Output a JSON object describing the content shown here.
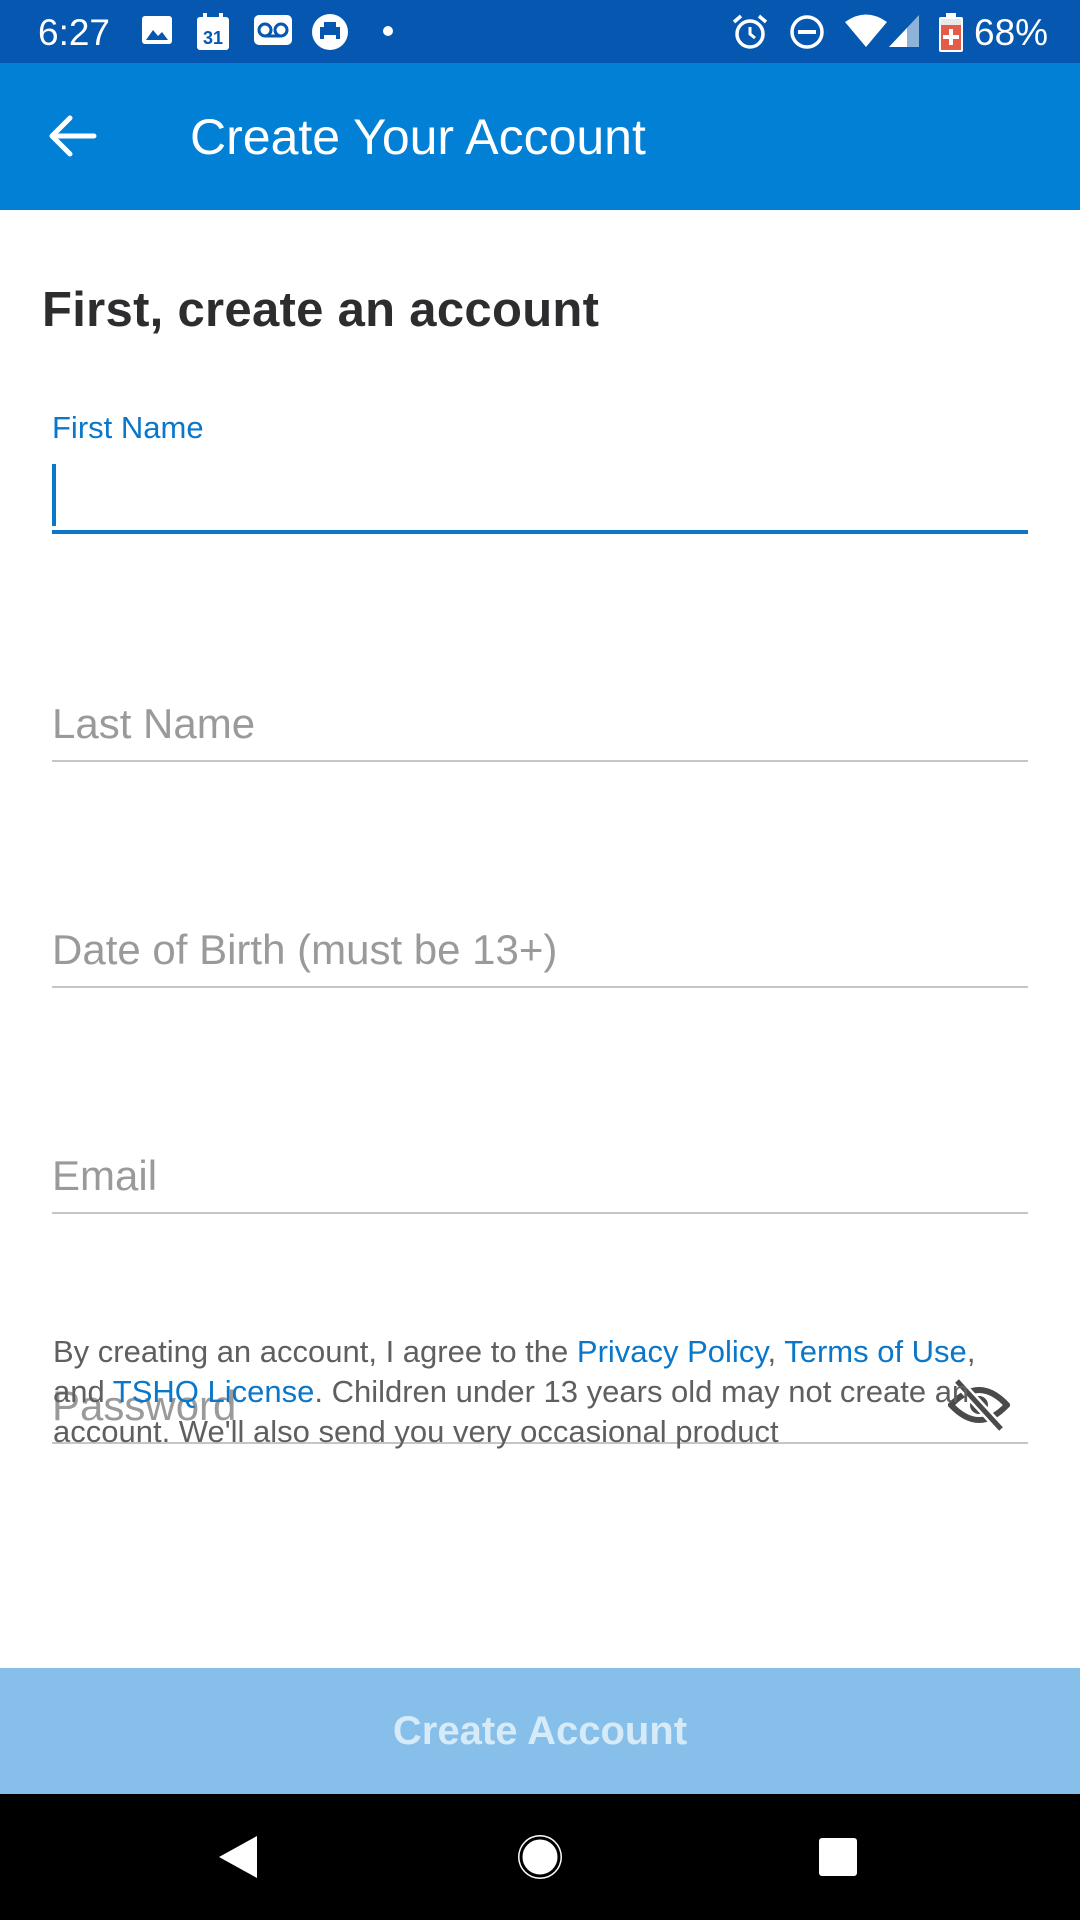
{
  "status_bar": {
    "time": "6:27",
    "battery_percent": "68%",
    "left_icons": [
      "image-icon",
      "calendar-icon",
      "voicemail-icon",
      "printer-icon",
      "dot-icon"
    ],
    "calendar_day": "31",
    "right_icons": [
      "alarm-icon",
      "do-not-disturb-icon",
      "wifi-icon",
      "cellular-signal-icon",
      "battery-icon"
    ]
  },
  "app_bar": {
    "title": "Create Your Account",
    "back_icon": "arrow-back-icon"
  },
  "form": {
    "heading": "First, create an account",
    "first_name": {
      "label": "First Name",
      "value": ""
    },
    "last_name": {
      "placeholder": "Last Name",
      "value": ""
    },
    "dob": {
      "placeholder": "Date of Birth (must be 13+)",
      "value": ""
    },
    "email": {
      "placeholder": "Email",
      "value": ""
    },
    "password": {
      "placeholder": "Password",
      "value": "",
      "toggle_icon": "eye-off-icon"
    }
  },
  "legal": {
    "text_1": "By creating an account, I agree to the ",
    "privacy_link": "Privacy Policy",
    "sep_1": ", ",
    "terms_link": "Terms of Use",
    "sep_2": ", and ",
    "license_link": "TSHQ License",
    "text_2": ". Children under 13 years old may not create an account. We'll also send you very occasional product"
  },
  "create_button": {
    "label": "Create Account"
  },
  "nav_bar": {
    "icons": [
      "back-triangle-icon",
      "home-circle-icon",
      "recents-square-icon"
    ]
  },
  "colors": {
    "status_bar": "#0557b0",
    "app_bar": "#0280d6",
    "accent": "#0a77c9",
    "button_disabled": "#86bfe9"
  }
}
